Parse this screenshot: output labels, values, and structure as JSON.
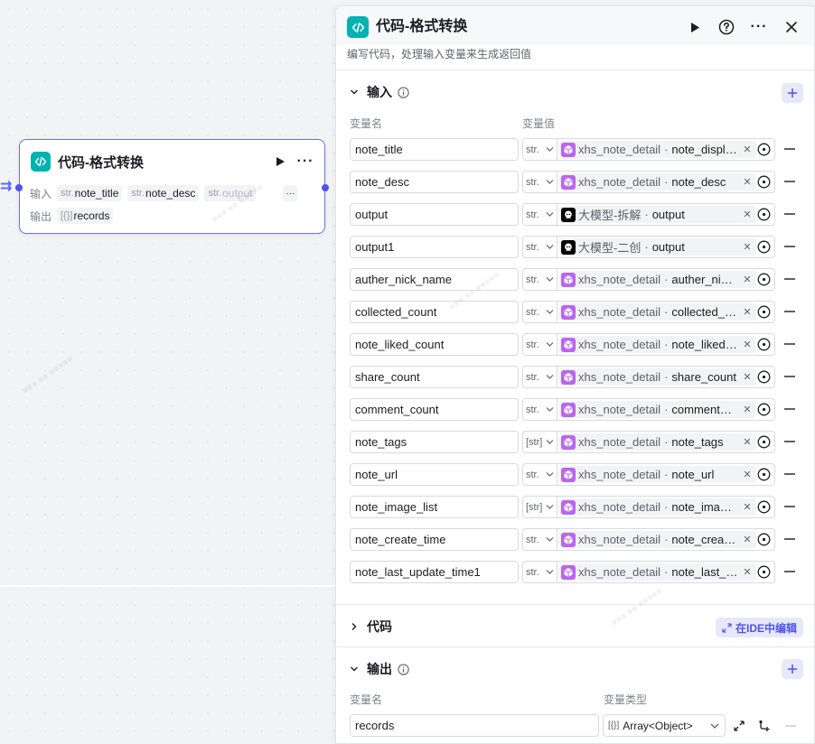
{
  "node": {
    "title": "代码-格式转换",
    "input_label": "输入",
    "output_label": "输出",
    "inputs": [
      {
        "type": "str.",
        "name": "note_title"
      },
      {
        "type": "str.",
        "name": "note_desc"
      },
      {
        "type": "str.",
        "name": "output"
      }
    ],
    "more_label": "···",
    "outputs": [
      {
        "type": "[{}]",
        "name": "records"
      }
    ]
  },
  "panel": {
    "title": "代码-格式转换",
    "description": "编写代码，处理输入变量来生成返回值",
    "input_section": {
      "label": "输入",
      "col_name": "变量名",
      "col_value": "变量值",
      "rows": [
        {
          "name": "note_title",
          "type": "str.",
          "icon": "cube-icon",
          "source": "xhs_note_detail",
          "var": "note_displa…"
        },
        {
          "name": "note_desc",
          "type": "str.",
          "icon": "cube-icon",
          "source": "xhs_note_detail",
          "var": "note_desc"
        },
        {
          "name": "output",
          "type": "str.",
          "icon": "llm-icon",
          "source": "大模型-拆解",
          "var": "output"
        },
        {
          "name": "output1",
          "type": "str.",
          "icon": "llm-icon",
          "source": "大模型-二创",
          "var": "output"
        },
        {
          "name": "auther_nick_name",
          "type": "str.",
          "icon": "cube-icon",
          "source": "xhs_note_detail",
          "var": "auther_nick…"
        },
        {
          "name": "collected_count",
          "type": "str.",
          "icon": "cube-icon",
          "source": "xhs_note_detail",
          "var": "collected_c…"
        },
        {
          "name": "note_liked_count",
          "type": "str.",
          "icon": "cube-icon",
          "source": "xhs_note_detail",
          "var": "note_liked_…"
        },
        {
          "name": "share_count",
          "type": "str.",
          "icon": "cube-icon",
          "source": "xhs_note_detail",
          "var": "share_count"
        },
        {
          "name": "comment_count",
          "type": "str.",
          "icon": "cube-icon",
          "source": "xhs_note_detail",
          "var": "comment_c…"
        },
        {
          "name": "note_tags",
          "type": "[str]",
          "icon": "cube-icon",
          "source": "xhs_note_detail",
          "var": "note_tags"
        },
        {
          "name": "note_url",
          "type": "str.",
          "icon": "cube-icon",
          "source": "xhs_note_detail",
          "var": "note_url"
        },
        {
          "name": "note_image_list",
          "type": "[str]",
          "icon": "cube-icon",
          "source": "xhs_note_detail",
          "var": "note_image…"
        },
        {
          "name": "note_create_time",
          "type": "str.",
          "icon": "cube-icon",
          "source": "xhs_note_detail",
          "var": "note_create…"
        },
        {
          "name": "note_last_update_time1",
          "type": "str.",
          "icon": "cube-icon",
          "source": "xhs_note_detail",
          "var": "note_last_u…"
        }
      ]
    },
    "code_section": {
      "label": "代码",
      "ide_button": "在IDE中编辑"
    },
    "output_section": {
      "label": "输出",
      "col_name": "变量名",
      "col_type": "变量类型",
      "rows": [
        {
          "name": "records",
          "type_icon": "[{}]",
          "type": "Array<Object>"
        }
      ]
    }
  },
  "colors": {
    "accent": "#4d53e8",
    "code_icon": "#00b2b2",
    "cube_icon": "#b866f0"
  }
}
